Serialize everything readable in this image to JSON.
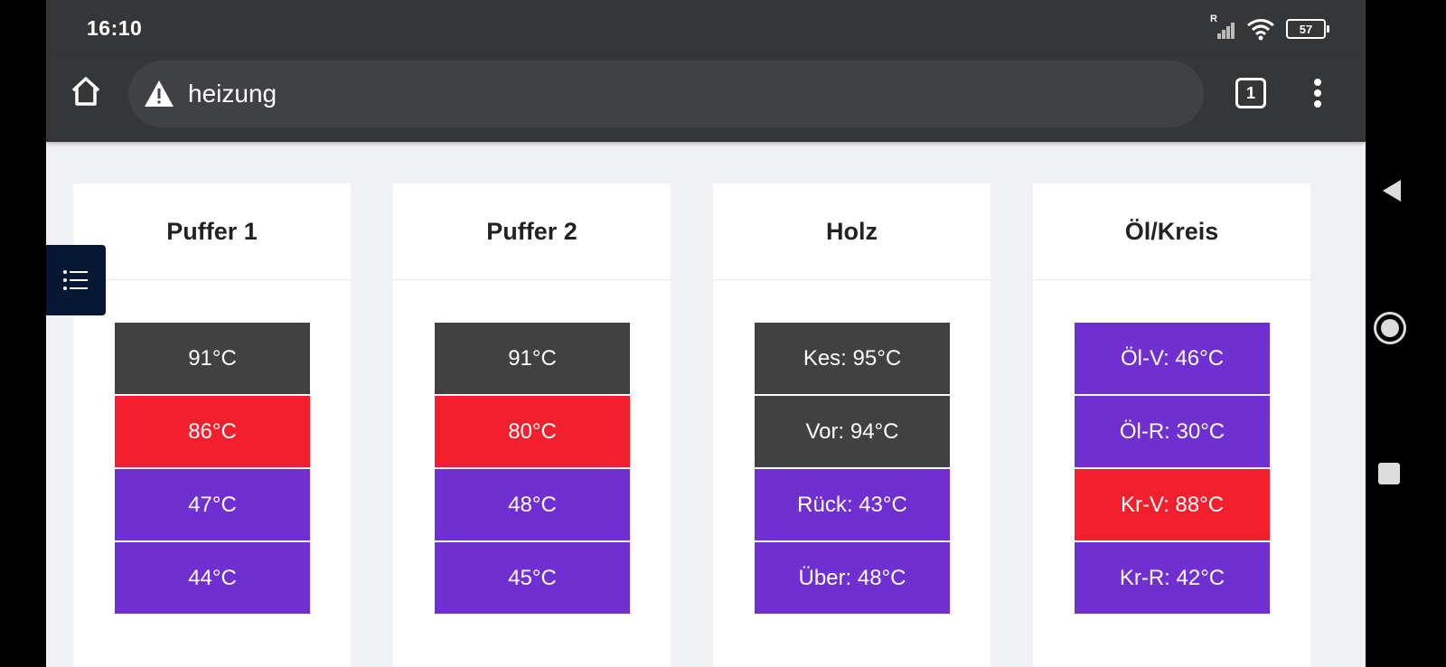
{
  "status_bar": {
    "time": "16:10",
    "signal_label": "R",
    "battery": "57"
  },
  "browser": {
    "url": "heizung",
    "tab_count": "1",
    "icons": [
      "home-icon",
      "warning-icon",
      "tabs-icon",
      "more-vert-icon"
    ]
  },
  "colors": {
    "dark": "#414141",
    "red": "#f41f2c",
    "purple": "#6f2fd1"
  },
  "cards": [
    {
      "title": "Puffer 1",
      "cells": [
        {
          "text": "91°C",
          "color": "dark"
        },
        {
          "text": "86°C",
          "color": "red"
        },
        {
          "text": "47°C",
          "color": "purple"
        },
        {
          "text": "44°C",
          "color": "purple"
        }
      ]
    },
    {
      "title": "Puffer 2",
      "cells": [
        {
          "text": "91°C",
          "color": "dark"
        },
        {
          "text": "80°C",
          "color": "red"
        },
        {
          "text": "48°C",
          "color": "purple"
        },
        {
          "text": "45°C",
          "color": "purple"
        }
      ]
    },
    {
      "title": "Holz",
      "cells": [
        {
          "text": "Kes: 95°C",
          "color": "dark"
        },
        {
          "text": "Vor: 94°C",
          "color": "dark"
        },
        {
          "text": "Rück: 43°C",
          "color": "purple"
        },
        {
          "text": "Über: 48°C",
          "color": "purple"
        }
      ]
    },
    {
      "title": "Öl/Kreis",
      "cells": [
        {
          "text": "Öl-V: 46°C",
          "color": "purple"
        },
        {
          "text": "Öl-R: 30°C",
          "color": "purple"
        },
        {
          "text": "Kr-V: 88°C",
          "color": "red"
        },
        {
          "text": "Kr-R: 42°C",
          "color": "purple"
        }
      ]
    }
  ],
  "side_toggle_icon": "list-icon",
  "nav": [
    "back-icon",
    "home-circle-icon",
    "recents-icon"
  ]
}
